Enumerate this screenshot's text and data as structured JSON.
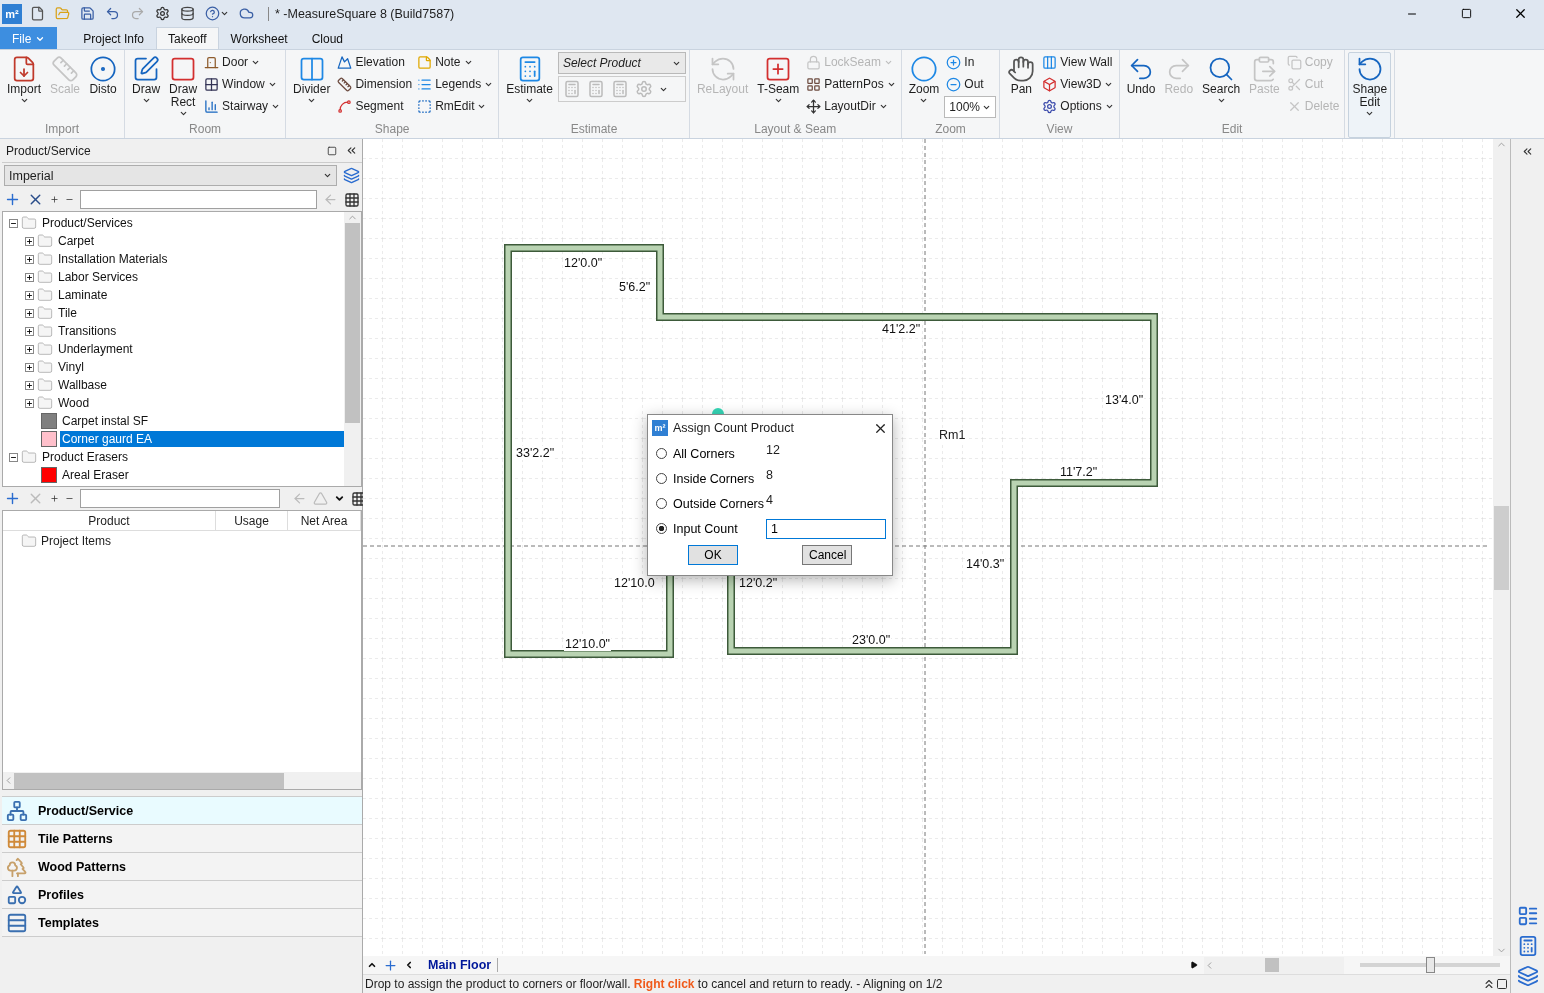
{
  "title_bar": {
    "logo": "m²",
    "title": "* -MeasureSquare 8 (Build7587)"
  },
  "ribbon_tabs": [
    {
      "label": "File",
      "kind": "file",
      "selected": false
    },
    {
      "label": "Project Info",
      "kind": "tab",
      "selected": false
    },
    {
      "label": "Takeoff",
      "kind": "tab",
      "selected": true
    },
    {
      "label": "Worksheet",
      "kind": "tab",
      "selected": false
    },
    {
      "label": "Cloud",
      "kind": "tab",
      "selected": false
    }
  ],
  "ribbon_groups": [
    {
      "label": "Import",
      "items": [
        {
          "kind": "large",
          "label": "Import",
          "disabled": false,
          "menu": true
        },
        {
          "kind": "large",
          "label": "Scale",
          "disabled": true,
          "menu": false
        },
        {
          "kind": "large",
          "label": "Disto",
          "disabled": false,
          "menu": false
        }
      ]
    },
    {
      "label": "Room",
      "items": [
        {
          "kind": "large",
          "label": "Draw",
          "disabled": false,
          "menu": true
        },
        {
          "kind": "large",
          "label": "Draw Rect",
          "disabled": false,
          "menu": true
        },
        {
          "kind": "small",
          "label": "Door",
          "disabled": false,
          "menu": true
        },
        {
          "kind": "small",
          "label": "Window",
          "disabled": false,
          "menu": true
        },
        {
          "kind": "small",
          "label": "Stairway",
          "disabled": false,
          "menu": true
        }
      ]
    },
    {
      "label": "Shape",
      "items": [
        {
          "kind": "large",
          "label": "Divider",
          "disabled": false,
          "menu": true
        },
        {
          "kind": "small",
          "label": "Elevation",
          "disabled": false,
          "menu": false
        },
        {
          "kind": "small",
          "label": "Dimension",
          "disabled": false,
          "menu": false
        },
        {
          "kind": "small",
          "label": "Segment",
          "disabled": false,
          "menu": false
        },
        {
          "kind": "small",
          "label": "Note",
          "disabled": false,
          "menu": true
        },
        {
          "kind": "small",
          "label": "Legends",
          "disabled": false,
          "menu": true
        },
        {
          "kind": "small",
          "label": "RmEdit",
          "disabled": false,
          "menu": true
        }
      ]
    },
    {
      "label": "Estimate",
      "items": [
        {
          "kind": "large",
          "label": "Estimate",
          "disabled": false,
          "menu": true
        },
        {
          "kind": "select",
          "value": "Select Product"
        },
        {
          "kind": "strip",
          "disabled": true
        }
      ]
    },
    {
      "label": "Layout & Seam",
      "items": [
        {
          "kind": "large",
          "label": "ReLayout",
          "disabled": true,
          "menu": false
        },
        {
          "kind": "large",
          "label": "T-Seam",
          "disabled": false,
          "menu": true
        },
        {
          "kind": "small",
          "label": "LockSeam",
          "disabled": true,
          "menu": true
        },
        {
          "kind": "small",
          "label": "PatternPos",
          "disabled": false,
          "menu": true
        },
        {
          "kind": "small",
          "label": "LayoutDir",
          "disabled": false,
          "menu": true
        }
      ]
    },
    {
      "label": "Zoom",
      "items": [
        {
          "kind": "large",
          "label": "Zoom",
          "disabled": false,
          "menu": true
        },
        {
          "kind": "small",
          "label": "In",
          "disabled": false,
          "menu": false
        },
        {
          "kind": "small",
          "label": "Out",
          "disabled": false,
          "menu": false
        },
        {
          "kind": "select",
          "value": "100%"
        }
      ]
    },
    {
      "label": "View",
      "items": [
        {
          "kind": "large",
          "label": "Pan",
          "disabled": false,
          "menu": false
        },
        {
          "kind": "small",
          "label": "View Wall",
          "disabled": false,
          "menu": false
        },
        {
          "kind": "small",
          "label": "View3D",
          "disabled": false,
          "menu": true
        },
        {
          "kind": "small",
          "label": "Options",
          "disabled": false,
          "menu": true
        }
      ]
    },
    {
      "label": "Edit",
      "items": [
        {
          "kind": "large",
          "label": "Undo",
          "disabled": false,
          "menu": false
        },
        {
          "kind": "large",
          "label": "Redo",
          "disabled": true,
          "menu": false
        },
        {
          "kind": "large",
          "label": "Search",
          "disabled": false,
          "menu": true
        },
        {
          "kind": "large",
          "label": "Paste",
          "disabled": true,
          "menu": false
        },
        {
          "kind": "small",
          "label": "Copy",
          "disabled": true,
          "menu": false
        },
        {
          "kind": "small",
          "label": "Cut",
          "disabled": true,
          "menu": false
        },
        {
          "kind": "small",
          "label": "Delete",
          "disabled": true,
          "menu": false
        }
      ]
    },
    {
      "items": [
        {
          "kind": "large",
          "label": "Shape Edit",
          "disabled": false,
          "menu": true,
          "highlighted": true
        }
      ]
    }
  ],
  "panel": {
    "title": "Product/Service",
    "unit_select": {
      "value": "Imperial"
    },
    "tree": [
      {
        "kind": "folder",
        "label": "Product/Services",
        "expanded": true,
        "selected": false,
        "children": [
          {
            "kind": "folder",
            "label": "Carpet",
            "expanded": false,
            "selected": false
          },
          {
            "kind": "folder",
            "label": "Installation Materials",
            "expanded": false,
            "selected": false
          },
          {
            "kind": "folder",
            "label": "Labor Services",
            "expanded": false,
            "selected": false
          },
          {
            "kind": "folder",
            "label": "Laminate",
            "expanded": false,
            "selected": false
          },
          {
            "kind": "folder",
            "label": "Tile",
            "expanded": false,
            "selected": false
          },
          {
            "kind": "folder",
            "label": "Transitions",
            "expanded": false,
            "selected": false
          },
          {
            "kind": "folder",
            "label": "Underlayment",
            "expanded": false,
            "selected": false
          },
          {
            "kind": "folder",
            "label": "Vinyl",
            "expanded": false,
            "selected": false
          },
          {
            "kind": "folder",
            "label": "Wallbase",
            "expanded": false,
            "selected": false
          },
          {
            "kind": "folder",
            "label": "Wood",
            "expanded": false,
            "selected": false
          },
          {
            "kind": "product",
            "label": "Carpet instal  SF",
            "color": "#808080",
            "selected": false
          },
          {
            "kind": "product",
            "label": "Corner gaurd  EA",
            "color": "#ffc0cb",
            "selected": true
          }
        ]
      },
      {
        "kind": "folder",
        "label": "Product Erasers",
        "expanded": true,
        "selected": false,
        "children": [
          {
            "kind": "product",
            "label": "Areal Eraser",
            "color": "#ff0000",
            "selected": false
          }
        ]
      }
    ],
    "table": {
      "columns": [
        "Product",
        "Usage",
        "Net Area"
      ],
      "rows": [
        {
          "label": "Project Items"
        }
      ]
    }
  },
  "nav_items": [
    {
      "label": "Product/Service",
      "selected": true
    },
    {
      "label": "Tile Patterns",
      "selected": false
    },
    {
      "label": "Wood Patterns",
      "selected": false
    },
    {
      "label": "Profiles",
      "selected": false
    },
    {
      "label": "Templates",
      "selected": false
    }
  ],
  "canvas": {
    "labels": [
      {
        "text": "12'0.0\"",
        "kind": "dimension"
      },
      {
        "text": "5'6.2\"",
        "kind": "dimension"
      },
      {
        "text": "41'2.2\"",
        "kind": "dimension"
      },
      {
        "text": "13'4.0\"",
        "kind": "dimension"
      },
      {
        "text": "Rm1",
        "kind": "room"
      },
      {
        "text": "33'2.2\"",
        "kind": "dimension"
      },
      {
        "text": "11'7.2\"",
        "kind": "dimension"
      },
      {
        "text": "12'10.0",
        "kind": "dimension"
      },
      {
        "text": "12'0.2\"",
        "kind": "dimension"
      },
      {
        "text": "14'0.3\"",
        "kind": "dimension"
      },
      {
        "text": "12'10.0\"",
        "kind": "dimension"
      },
      {
        "text": "23'0.0\"",
        "kind": "dimension"
      }
    ]
  },
  "dialog": {
    "icon_text": "m²",
    "title": "Assign Count Product",
    "options": [
      {
        "kind": "count",
        "label": "All Corners",
        "count": "12",
        "selected": false
      },
      {
        "kind": "count",
        "label": "Inside Corners",
        "count": "8",
        "selected": false
      },
      {
        "kind": "count",
        "label": "Outside Corners",
        "count": "4",
        "selected": false
      },
      {
        "kind": "input",
        "label": "Input Count",
        "value": "1",
        "selected": true
      }
    ],
    "buttons": [
      {
        "label": "OK",
        "default": true
      },
      {
        "label": "Cancel",
        "default": false
      }
    ]
  },
  "sheet_tabs": [
    {
      "label": "Main Floor",
      "selected": true
    }
  ],
  "zoom_slider": {
    "level": 0.5
  },
  "status": "Drop to assign the product to corners or floor/wall. **Right click** to cancel and return to ready. - Aligning on 1/2"
}
